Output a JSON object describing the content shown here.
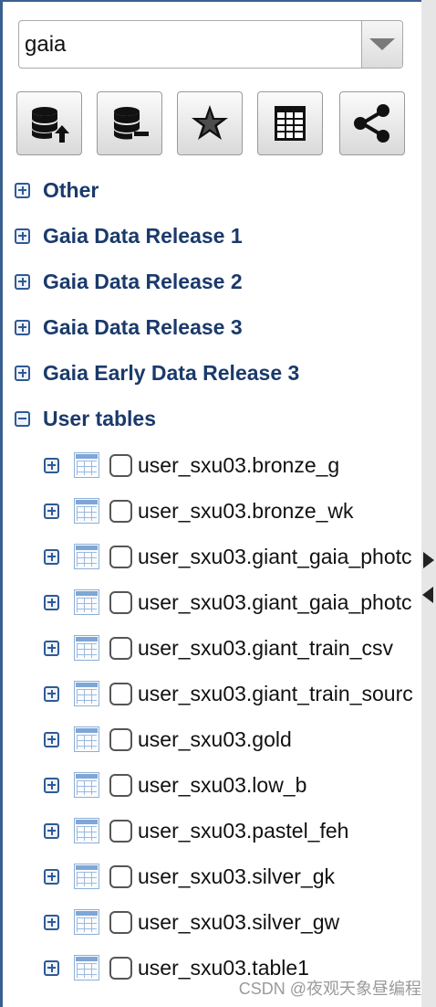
{
  "catalog_select": {
    "value": "gaia"
  },
  "toolbar": {
    "buttons": [
      {
        "icon": "database-upload-icon"
      },
      {
        "icon": "database-remove-icon"
      },
      {
        "icon": "star-icon"
      },
      {
        "icon": "table-icon"
      },
      {
        "icon": "share-icon"
      }
    ]
  },
  "tree": {
    "groups": [
      {
        "label": "Other",
        "expanded": false
      },
      {
        "label": "Gaia Data Release 1",
        "expanded": false
      },
      {
        "label": "Gaia Data Release 2",
        "expanded": false
      },
      {
        "label": "Gaia Data Release 3",
        "expanded": false
      },
      {
        "label": "Gaia Early Data Release 3",
        "expanded": false
      },
      {
        "label": "User tables",
        "expanded": true
      }
    ],
    "user_tables": [
      {
        "label": "user_sxu03.bronze_g"
      },
      {
        "label": "user_sxu03.bronze_wk"
      },
      {
        "label": "user_sxu03.giant_gaia_photc"
      },
      {
        "label": "user_sxu03.giant_gaia_photc"
      },
      {
        "label": "user_sxu03.giant_train_csv"
      },
      {
        "label": "user_sxu03.giant_train_sourc"
      },
      {
        "label": "user_sxu03.gold"
      },
      {
        "label": "user_sxu03.low_b"
      },
      {
        "label": "user_sxu03.pastel_feh"
      },
      {
        "label": "user_sxu03.silver_gk"
      },
      {
        "label": "user_sxu03.silver_gw"
      },
      {
        "label": "user_sxu03.table1"
      }
    ]
  },
  "watermark": "CSDN @夜观天象昼编程",
  "colors": {
    "accent": "#1a3a6b",
    "border": "#3a5f8f",
    "icon": "#2f5a94"
  }
}
